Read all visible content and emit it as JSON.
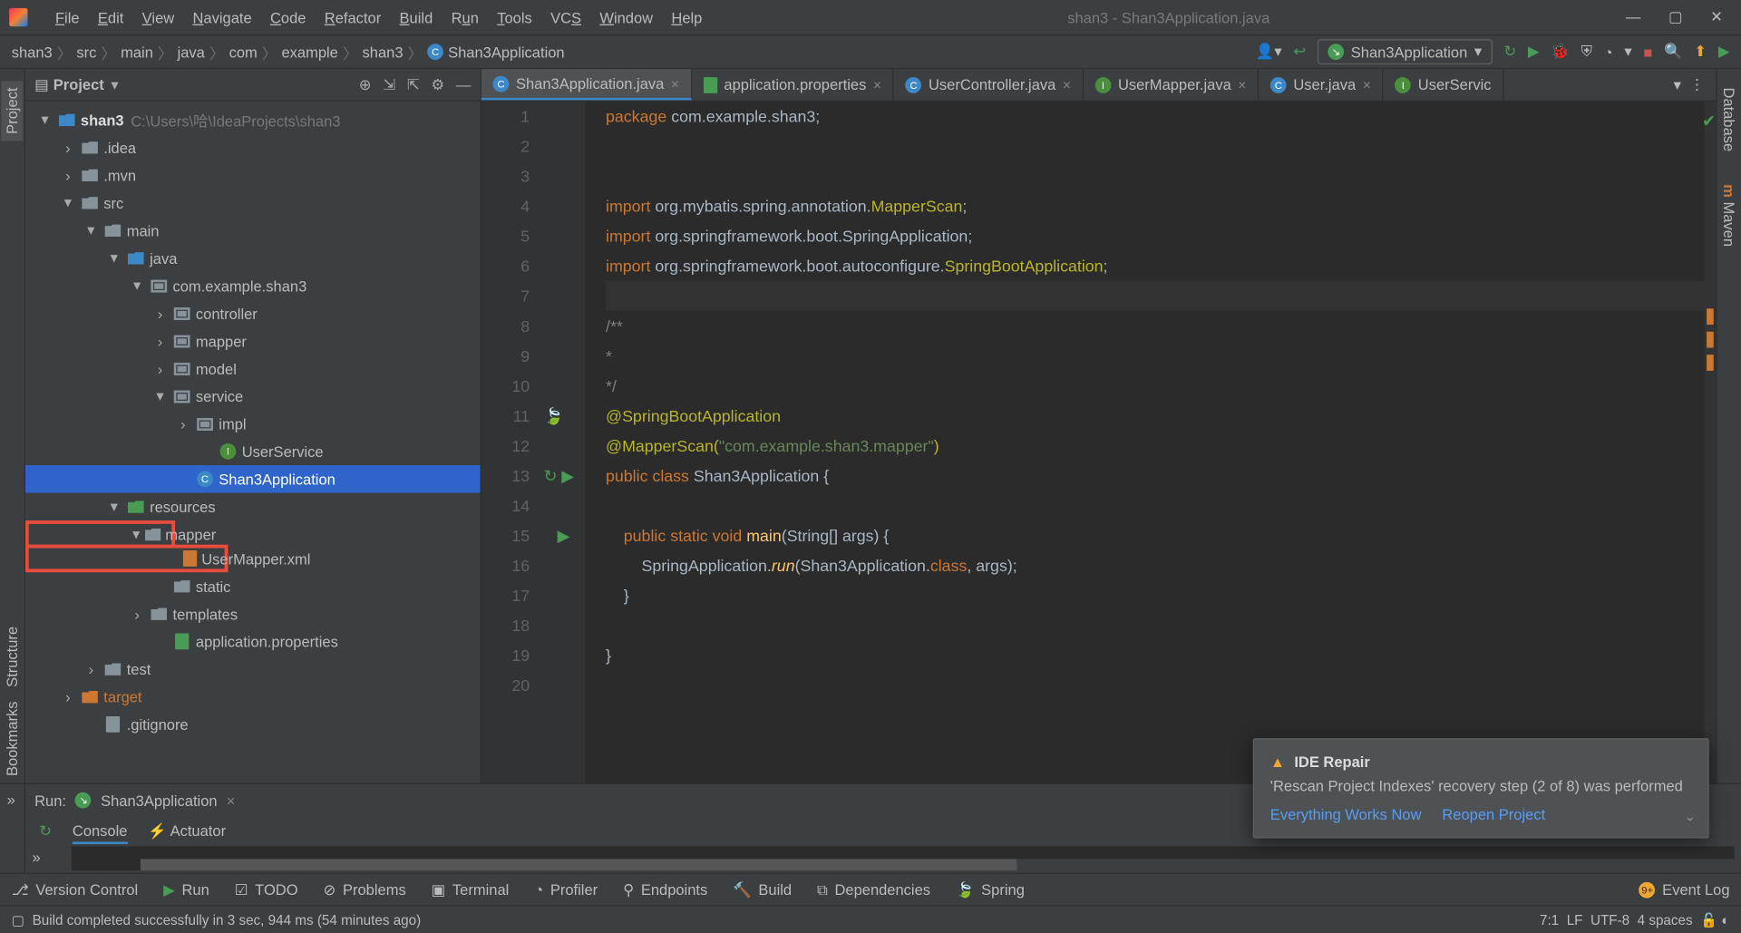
{
  "title": {
    "project": "shan3",
    "file": "Shan3Application.java"
  },
  "menu": [
    "File",
    "Edit",
    "View",
    "Navigate",
    "Code",
    "Refactor",
    "Build",
    "Run",
    "Tools",
    "VCS",
    "Window",
    "Help"
  ],
  "breadcrumbs": [
    "shan3",
    "src",
    "main",
    "java",
    "com",
    "example",
    "shan3",
    "Shan3Application"
  ],
  "runConfig": "Shan3Application",
  "projectPanel": {
    "title": "Project"
  },
  "tree": {
    "root": "shan3",
    "rootPath": "C:\\Users\\哈\\IdeaProjects\\shan3",
    "idea": ".idea",
    "mvn": ".mvn",
    "src": "src",
    "main": "main",
    "java": "java",
    "pkg": "com.example.shan3",
    "controller": "controller",
    "mapperPkg": "mapper",
    "model": "model",
    "service": "service",
    "impl": "impl",
    "userService": "UserService",
    "shan3App": "Shan3Application",
    "resources": "resources",
    "mapperFolder": "mapper",
    "userMapperXml": "UserMapper.xml",
    "static": "static",
    "templates": "templates",
    "appProps": "application.properties",
    "test": "test",
    "target": "target",
    "gitignore": ".gitignore"
  },
  "tabs": [
    {
      "label": "Shan3Application.java",
      "active": true
    },
    {
      "label": "application.properties",
      "active": false
    },
    {
      "label": "UserController.java",
      "active": false
    },
    {
      "label": "UserMapper.java",
      "active": false
    },
    {
      "label": "User.java",
      "active": false
    },
    {
      "label": "UserServic",
      "active": false
    }
  ],
  "code": {
    "l1": {
      "kw": "package",
      "rest": " com.example.shan3;"
    },
    "l4": {
      "kw": "import",
      "rest": " org.mybatis.spring.annotation.",
      "cls": "MapperScan",
      ";": ";"
    },
    "l5": {
      "kw": "import",
      "rest": " org.springframework.boot.",
      "cls": "SpringApplication",
      ";": ";"
    },
    "l6": {
      "kw": "import",
      "rest": " org.springframework.boot.autoconfigure.",
      "cls": "SpringBootApplication",
      ";": ";"
    },
    "l8": "/**",
    "l9": " *",
    "l10": " */",
    "l11": "@SpringBootApplication",
    "l12a": "@MapperScan(",
    "l12b": "\"com.example.shan3.mapper\"",
    "l12c": ")",
    "l13": {
      "kw1": "public",
      "kw2": "class",
      "cls": "Shan3Application",
      "br": "{"
    },
    "l15": {
      "kw1": "public",
      "kw2": "static",
      "kw3": "void",
      "mth": "main",
      "args": "(String[] args) {"
    },
    "l16": {
      "a": "SpringApplication.",
      "m": "run",
      "b": "(Shan3Application.",
      "kw": "class",
      "c": ", args);"
    },
    "l17": "}",
    "l19": "}"
  },
  "lineNumbers": [
    "1",
    "2",
    "3",
    "4",
    "5",
    "6",
    "7",
    "8",
    "9",
    "10",
    "11",
    "12",
    "13",
    "14",
    "15",
    "16",
    "17",
    "18",
    "19",
    "20"
  ],
  "runTool": {
    "label": "Run:",
    "config": "Shan3Application",
    "console": "Console",
    "actuator": "Actuator"
  },
  "bottomTools": [
    "Version Control",
    "Run",
    "TODO",
    "Problems",
    "Terminal",
    "Profiler",
    "Endpoints",
    "Build",
    "Dependencies",
    "Spring"
  ],
  "eventLog": "Event Log",
  "status": {
    "build": "Build completed successfully in 3 sec, 944 ms (54 minutes ago)",
    "pos": "7:1",
    "le": "LF",
    "enc": "UTF-8",
    "indent": "4 spaces"
  },
  "notification": {
    "title": "IDE Repair",
    "body": "'Rescan Project Indexes' recovery step (2 of 8) was performed",
    "link1": "Everything Works Now",
    "link2": "Reopen Project"
  },
  "rightTabs": [
    "Database",
    "Maven"
  ],
  "leftTabs": [
    "Project",
    "Structure",
    "Bookmarks"
  ]
}
